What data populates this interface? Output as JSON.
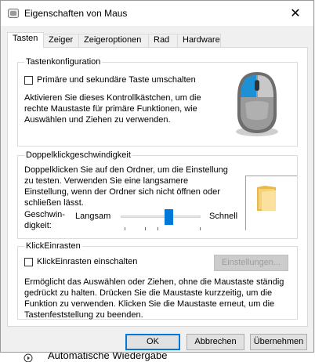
{
  "window": {
    "title": "Eigenschaften von Maus",
    "close_glyph": "✕"
  },
  "tabs": [
    "Tasten",
    "Zeiger",
    "Zeigeroptionen",
    "Rad",
    "Hardware"
  ],
  "button_config": {
    "label": "Tastenkonfiguration",
    "checkbox_label": "Primäre und sekundäre Taste umschalten",
    "checked": false,
    "desc_lines": [
      "Aktivieren Sie dieses Kontrollkästchen, um die",
      "rechte Maustaste für primäre Funktionen, wie",
      "Auswählen und Ziehen zu verwenden."
    ]
  },
  "double_click": {
    "label": "Doppelklickgeschwindigkeit",
    "desc_lines": [
      "Doppelklicken Sie auf den Ordner, um die Einstellung",
      "zu testen. Verwenden Sie eine langsamere",
      "Einstellung, wenn der Ordner sich nicht öffnen oder",
      "schließen lässt."
    ],
    "speed_label_1": "Geschwin-",
    "speed_label_2": "digkeit:",
    "slow": "Langsam",
    "fast": "Schnell",
    "slider_fraction": 0.6
  },
  "clicklock": {
    "label": "KlickEinrasten",
    "checkbox_label": "KlickEinrasten einschalten",
    "checked": false,
    "settings_button": "Einstellungen...",
    "desc_lines": [
      "Ermöglicht das Auswählen oder Ziehen, ohne die Maustaste ständig",
      "gedrückt zu halten. Drücken Sie die Maustaste kurzzeitig, um die",
      "Funktion zu verwenden. Klicken Sie die Maustaste erneut, um die",
      "Tastenfeststellung zu beenden."
    ]
  },
  "buttons": {
    "ok": "OK",
    "cancel": "Abbrechen",
    "apply": "Übernehmen"
  },
  "background_item": {
    "icon": "play-icon",
    "text": "Automatische Wiedergabe"
  },
  "colors": {
    "accent": "#0078d7",
    "mouse_highlight": "#1e90d6"
  }
}
